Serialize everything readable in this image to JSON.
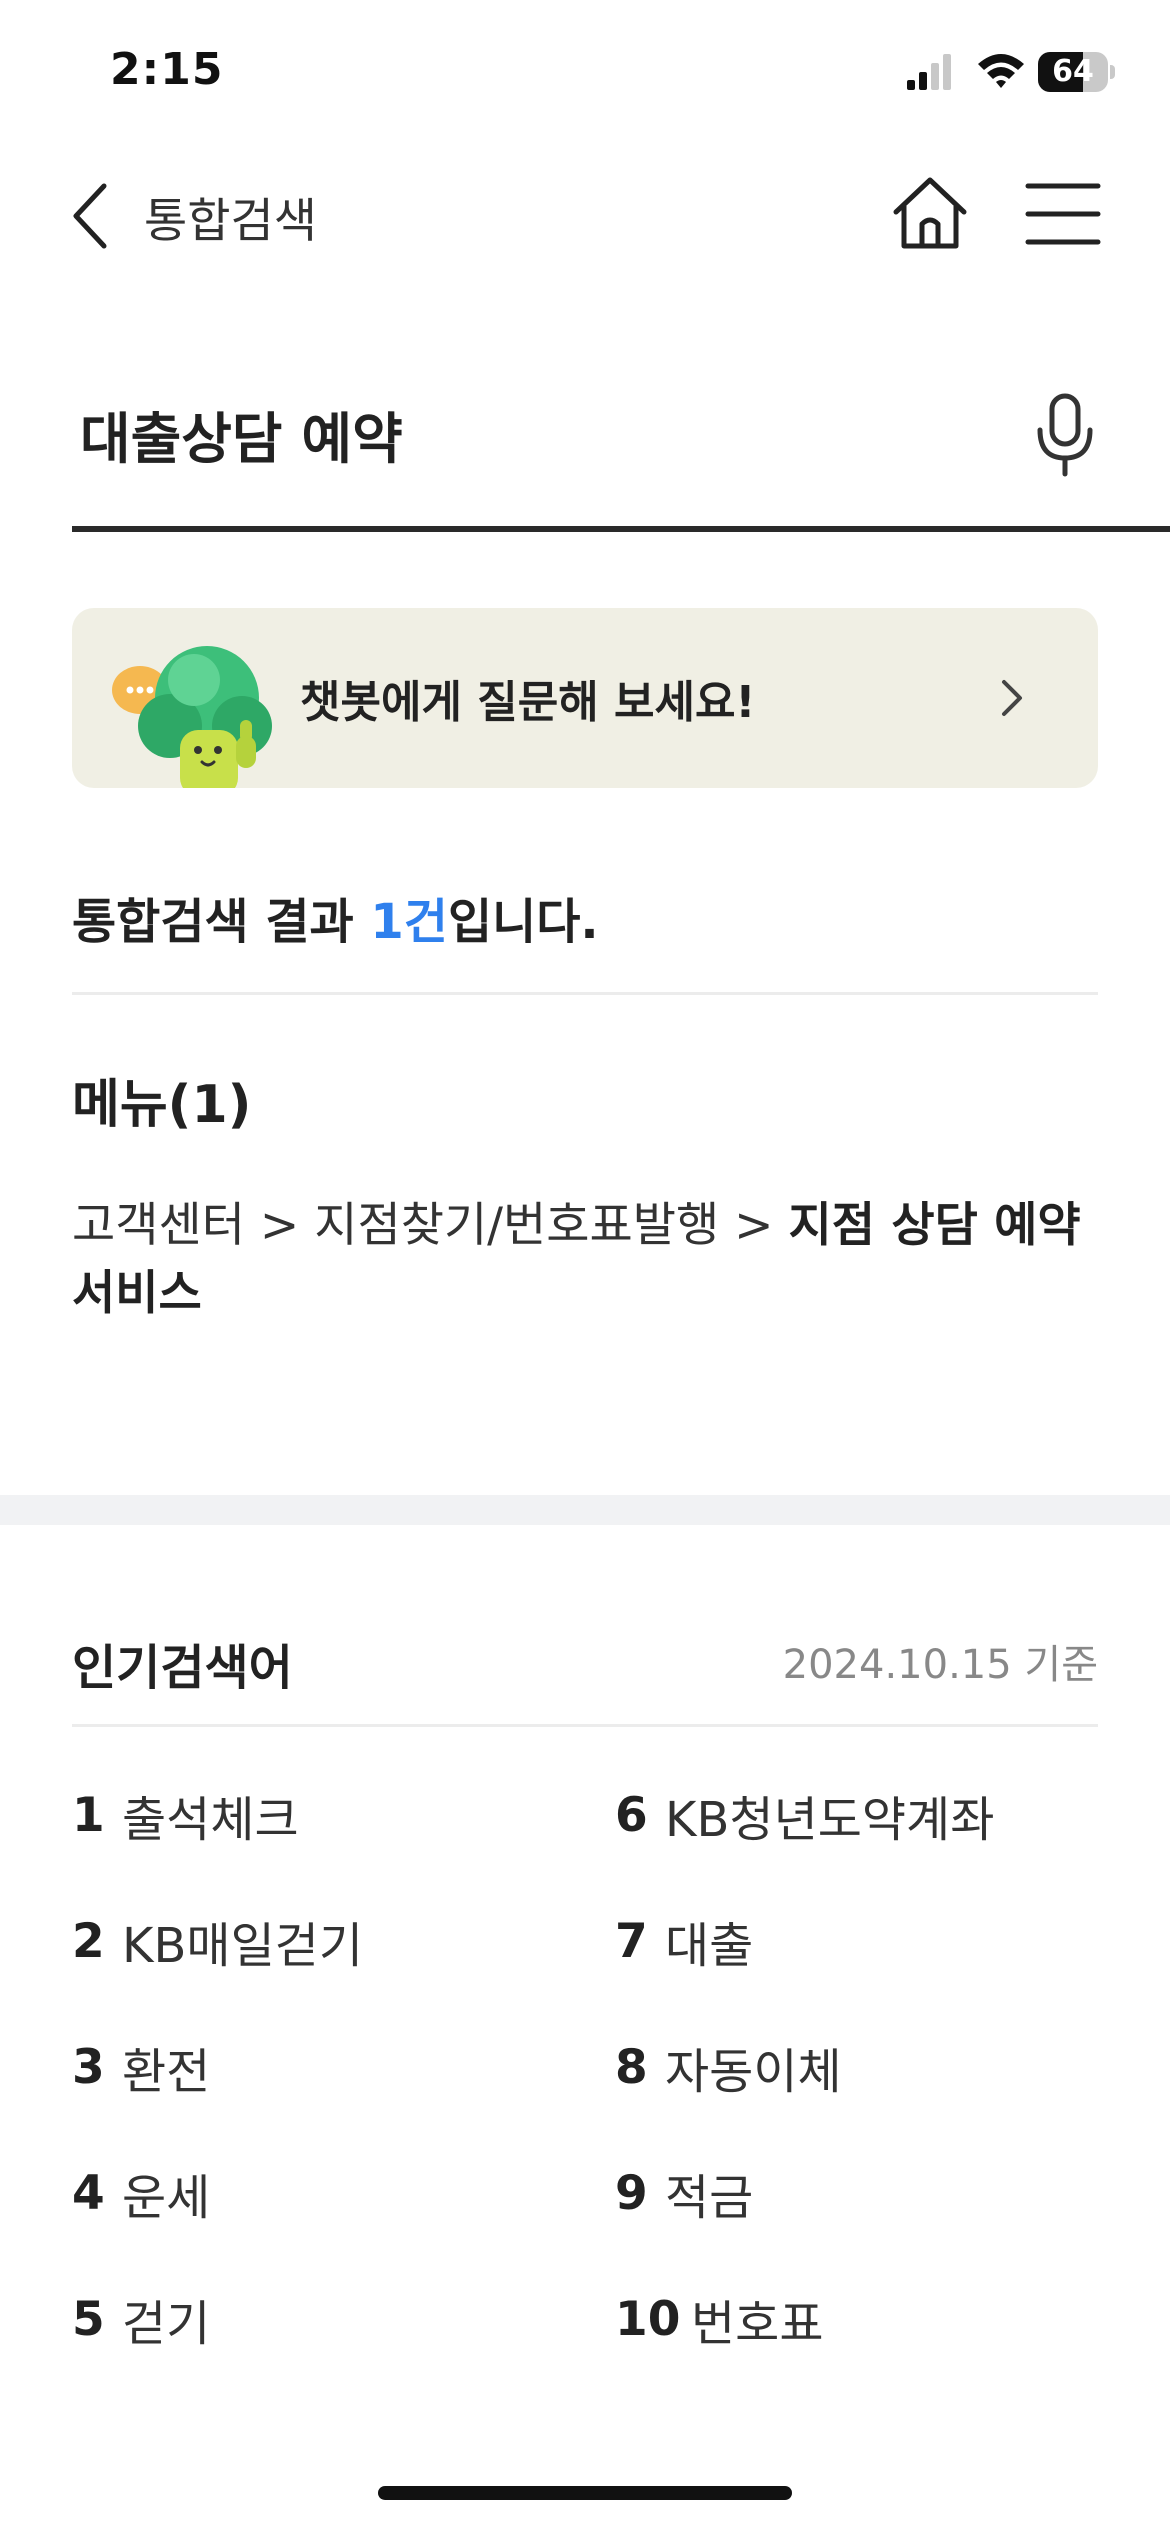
{
  "status_bar": {
    "time": "2:15",
    "battery": "64",
    "battery_level": 0.64
  },
  "header": {
    "title": "통합검색"
  },
  "search": {
    "query": "대출상담 예약"
  },
  "chatbot": {
    "text": "챗봇에게 질문해 보세요!"
  },
  "results": {
    "summary_prefix": "통합검색 결과 ",
    "summary_count": "1건",
    "summary_suffix": "입니다.",
    "menu_section_title": "메뉴(1)",
    "menu_path": "고객센터 > 지점찾기/번호표발행 > ",
    "menu_target": "지점 상담 예약서비스"
  },
  "popular": {
    "title": "인기검색어",
    "date": "2024.10.15 기준",
    "items": [
      {
        "rank": "1",
        "label": "출석체크"
      },
      {
        "rank": "2",
        "label": "KB매일걷기"
      },
      {
        "rank": "3",
        "label": "환전"
      },
      {
        "rank": "4",
        "label": "운세"
      },
      {
        "rank": "5",
        "label": "걷기"
      },
      {
        "rank": "6",
        "label": "KB청년도약계좌"
      },
      {
        "rank": "7",
        "label": "대출"
      },
      {
        "rank": "8",
        "label": "자동이체"
      },
      {
        "rank": "9",
        "label": "적금"
      },
      {
        "rank": "10",
        "label": "번호표"
      }
    ]
  },
  "colors": {
    "accent": "#2f80ed",
    "banner_bg": "#f0efe4",
    "divider": "#ececec",
    "section_band": "#f1f2f4"
  }
}
